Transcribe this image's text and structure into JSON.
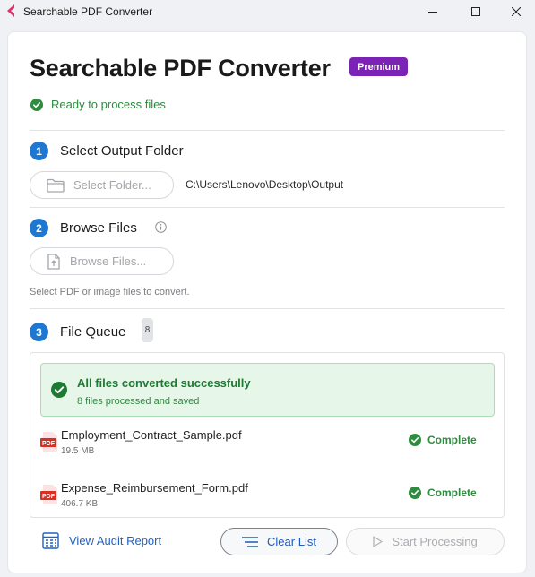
{
  "window": {
    "title": "Searchable PDF Converter",
    "controls": [
      "minimize-icon",
      "maximize-icon",
      "close-icon"
    ]
  },
  "header": {
    "title": "Searchable PDF Converter",
    "badge": "Premium",
    "status": "Ready to process files"
  },
  "step1": {
    "number": "1",
    "title": "Select Output Folder",
    "button_label": "Select Folder...",
    "button_icon": "folder-icon",
    "path": "C:\\Users\\Lenovo\\Desktop\\Output"
  },
  "step2": {
    "number": "2",
    "title": "Browse Files",
    "info_icon": "info-icon",
    "button_label": "Browse Files...",
    "button_icon": "upload-file-icon",
    "hint": "Select PDF or image files to convert."
  },
  "step3": {
    "number": "3",
    "title": "File Queue",
    "count": "8"
  },
  "queue": {
    "banner_title": "All files converted successfully",
    "banner_subtitle": "8 files processed and saved",
    "files": [
      {
        "name": "Employment_Contract_Sample.pdf",
        "size": "19.5 MB",
        "status": "Complete"
      },
      {
        "name": "Expense_Reimbursement_Form.pdf",
        "size": "406.7 KB",
        "status": "Complete"
      }
    ]
  },
  "footer": {
    "audit_label": "View Audit Report",
    "clear_label": "Clear List",
    "start_label": "Start Processing"
  },
  "colors": {
    "accent": "#1e78d2",
    "premium": "#7b23b5",
    "success": "#2e8b3f",
    "link": "#1e62c4"
  }
}
